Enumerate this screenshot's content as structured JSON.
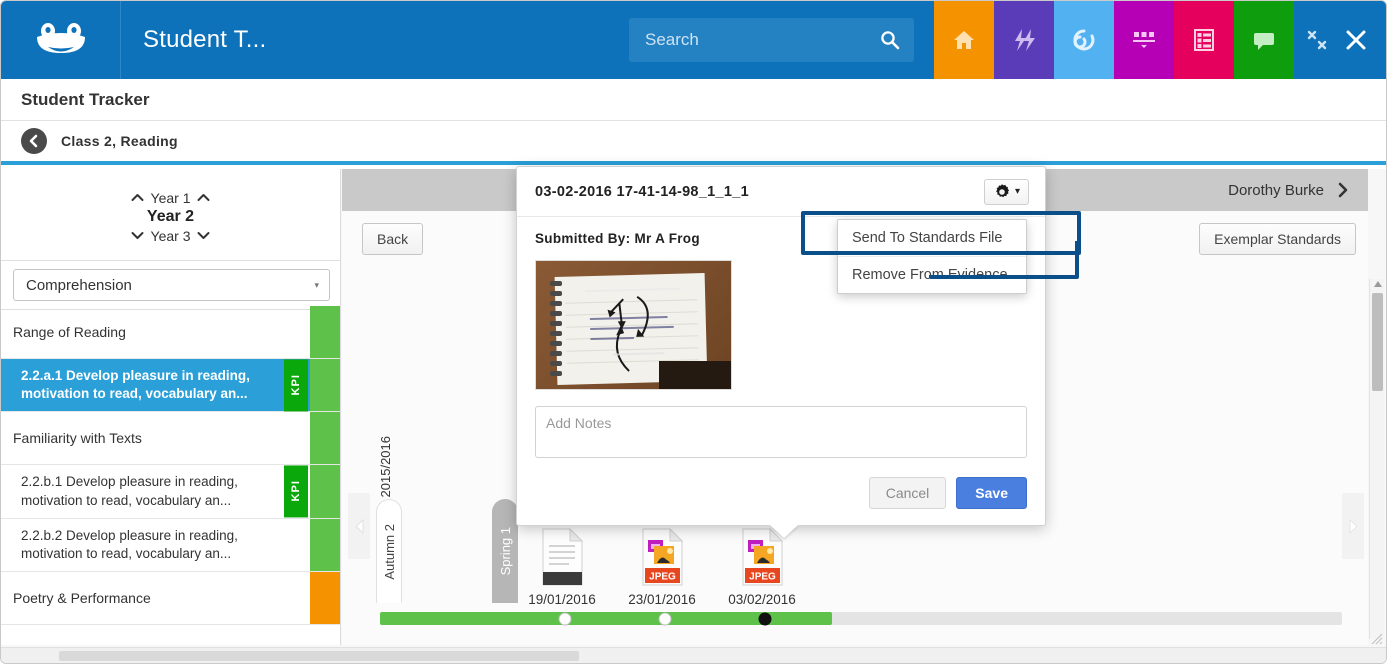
{
  "topbar": {
    "logo_icon": "frog-logo-icon",
    "app_title": "Student T...",
    "search": {
      "placeholder": "Search",
      "value": "",
      "icon": "search-icon"
    },
    "nav_icons": [
      {
        "name": "home-icon",
        "color": "#f59200"
      },
      {
        "name": "lightning-icon",
        "color": "#5b3cb8"
      },
      {
        "name": "refresh-icon",
        "color": "#52b1f0"
      },
      {
        "name": "apps-icon",
        "color": "#b500b5"
      },
      {
        "name": "list-icon",
        "color": "#e4005c"
      },
      {
        "name": "chat-icon",
        "color": "#0d9d0d"
      }
    ],
    "window_controls": [
      {
        "name": "minimize-icon"
      },
      {
        "name": "close-icon"
      }
    ]
  },
  "page": {
    "title": "Student Tracker",
    "breadcrumb": "Class 2, Reading",
    "back_icon": "back-arrow-icon"
  },
  "left_panel": {
    "year_prev": "Year 1",
    "year_current": "Year 2",
    "year_next": "Year 3",
    "subject_select": {
      "value": "Comprehension",
      "caret": "▾"
    },
    "rows": [
      {
        "label": "Range of Reading",
        "type": "group",
        "kpi": false,
        "status": "#5ec24a",
        "selected": false
      },
      {
        "label": "2.2.a.1 Develop pleasure in reading, motivation to read, vocabulary an...",
        "type": "standard",
        "kpi": true,
        "kpi_label": "KPI",
        "status": "#5ec24a",
        "selected": true
      },
      {
        "label": "Familiarity with Texts",
        "type": "group",
        "kpi": false,
        "status": "#5ec24a",
        "selected": false
      },
      {
        "label": "2.2.b.1 Develop pleasure in reading, motivation to read, vocabulary an...",
        "type": "standard",
        "kpi": true,
        "kpi_label": "KPI",
        "status": "#5ec24a",
        "selected": false
      },
      {
        "label": "2.2.b.2 Develop pleasure in reading, motivation to read, vocabulary an...",
        "type": "standard",
        "kpi": false,
        "status": "#5ec24a",
        "selected": false
      },
      {
        "label": "Poetry & Performance",
        "type": "group",
        "kpi": false,
        "status": "#f59200",
        "selected": false
      }
    ]
  },
  "content": {
    "pupil_name": "Dorothy Burke",
    "pupil_next_icon": "chevron-right-icon",
    "back_button": "Back",
    "exemplar_button": "Exemplar Standards"
  },
  "timeline": {
    "academic_year": "2015/2016",
    "terms": [
      {
        "label": "Autumn 2",
        "style": "white"
      },
      {
        "label": "Spring 1",
        "style": "gray"
      }
    ],
    "evidence": [
      {
        "date": "19/01/2016",
        "icon": "document-file-icon",
        "type": "doc",
        "active": false
      },
      {
        "date": "23/01/2016",
        "icon": "jpeg-file-icon",
        "type": "JPEG",
        "active": false
      },
      {
        "date": "03/02/2016",
        "icon": "jpeg-file-icon",
        "type": "JPEG",
        "active": true
      }
    ],
    "prev_icon": "left-arrow-icon",
    "next_icon": "right-arrow-icon",
    "track_fill_color": "#5ec24a"
  },
  "popup": {
    "title": "03-02-2016 17-41-14-98_1_1_1",
    "gear_icon": "gear-icon",
    "gear_caret": "▾",
    "submitted_by": "Submitted By: Mr A Frog",
    "thumbnail_alt": "notebook-photo-thumbnail",
    "notes_placeholder": "Add Notes",
    "notes_value": "",
    "cancel_label": "Cancel",
    "save_label": "Save"
  },
  "gear_menu": {
    "items": [
      {
        "label": "Send To Standards File"
      },
      {
        "label": "Remove From Evidence"
      }
    ]
  },
  "annotation": {
    "color": "#0b4f8a"
  }
}
